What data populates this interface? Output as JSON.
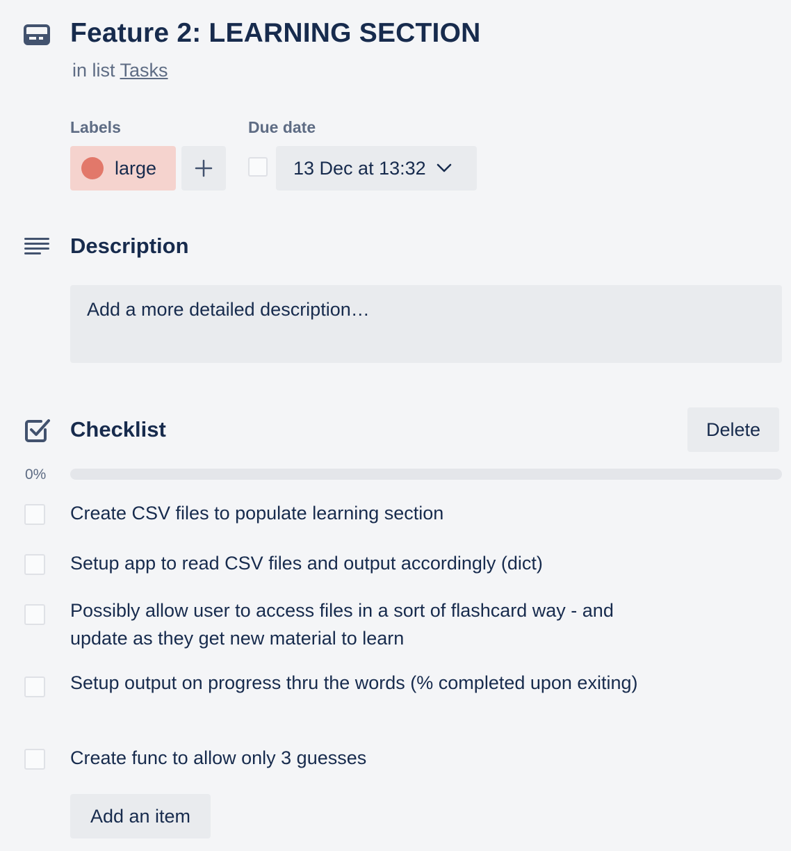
{
  "card": {
    "title": "Feature 2: LEARNING SECTION",
    "in_list_prefix": "in list",
    "list_name": "Tasks"
  },
  "labels": {
    "caption": "Labels",
    "items": [
      {
        "text": "large",
        "color": "#e2786a",
        "background": "#f5d3ce"
      }
    ],
    "add_icon": "plus-icon"
  },
  "due_date": {
    "caption": "Due date",
    "value": "13 Dec at 13:32",
    "completed": false,
    "dropdown_icon": "chevron-down-icon"
  },
  "description": {
    "title": "Description",
    "placeholder": "Add a more detailed description…"
  },
  "checklist": {
    "title": "Checklist",
    "delete_label": "Delete",
    "progress_text": "0%",
    "progress": 0,
    "items": [
      {
        "text": "Create CSV files to populate learning section",
        "checked": false
      },
      {
        "text": "Setup app to read CSV files and output accordingly (dict)",
        "checked": false
      },
      {
        "text": "Possibly allow user to access files in a sort of flashcard way - and update as they get new material to learn",
        "checked": false
      },
      {
        "text": "Setup output on progress thru the words (% completed upon exiting)",
        "checked": false
      },
      {
        "text": "Create func to allow only 3 guesses",
        "checked": false
      }
    ],
    "add_item_label": "Add an item"
  },
  "colors": {
    "text": "#172b4d",
    "subtle_text": "#5e6c84",
    "background": "#f4f5f7",
    "button_bg": "#e9ebee"
  }
}
